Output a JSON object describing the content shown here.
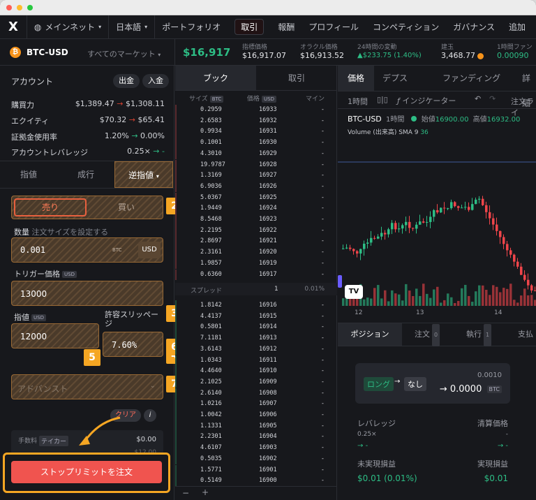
{
  "window": {
    "close_color": "#ff5f57",
    "min_color": "#febc2e",
    "max_color": "#28c840"
  },
  "topnav": {
    "logo": "X",
    "network": "メインネット",
    "language": "日本語",
    "items": [
      "ポートフォリオ",
      "取引",
      "報酬",
      "プロフィール",
      "コンペティション",
      "ガバナンス",
      "追加"
    ],
    "active": "取引",
    "globe_icon": "globe-icon",
    "chevron_icon": "chevron-down-icon"
  },
  "market": {
    "symbol": "BTC-USD",
    "all_markets": "すべてのマーケット",
    "price": "$16,917",
    "stats": [
      {
        "label": "指標価格",
        "value": "$16,917.07"
      },
      {
        "label": "オラクル価格",
        "value": "$16,913.52"
      },
      {
        "label": "24時間の変動",
        "value": "$233.75 (1.40%)"
      },
      {
        "label": "建玉",
        "value": "3,468.77"
      },
      {
        "label": "1時間ファン",
        "value": "0.00090"
      }
    ],
    "up_color": "#2dbd85",
    "accent": "#d4402f"
  },
  "account": {
    "title": "アカウント",
    "withdraw": "出金",
    "deposit": "入金",
    "rows": [
      {
        "label": "購買力",
        "from": "$1,389.47",
        "to": "$1,308.11"
      },
      {
        "label": "エクイティ",
        "from": "$70.32",
        "to": "$65.41"
      },
      {
        "label": "証拠金使用率",
        "from": "1.20%",
        "to": "0.00%"
      },
      {
        "label": "アカウントレバレッジ",
        "from": "0.25×",
        "to": "-"
      }
    ]
  },
  "order": {
    "tabs": [
      "指値",
      "成行",
      "逆指値"
    ],
    "active_tab": "逆指値",
    "sell": "売り",
    "buy": "買い",
    "amount_label": "数量",
    "amount_hint": "注文サイズを設定する",
    "amount_value": "0.001",
    "amount_unit": "BTC",
    "amount_toggle": "USD",
    "trigger_label": "トリガー価格",
    "trigger_unit": "USD",
    "trigger_value": "13000",
    "limit_label": "指値",
    "limit_unit": "USD",
    "limit_value": "12000",
    "slippage_label": "許容スリッページ",
    "slippage_value": "7.60%",
    "advanced": "アドバンスト",
    "clear": "クリア",
    "info": "i",
    "fee_label": "手数料",
    "fee_tag": "テイカー",
    "fee_value": "$0.00",
    "total_value": "$12.00",
    "submit": "ストップリミットを注文",
    "submit_color": "#f0544f"
  },
  "badges": [
    "1",
    "2",
    "3",
    "4",
    "5",
    "6",
    "7"
  ],
  "orderbook": {
    "tabs": [
      "ブック",
      "取引"
    ],
    "active_tab": "ブック",
    "head_size": "サイズ",
    "head_size_tag": "BTC",
    "head_price": "価格",
    "head_price_tag": "USD",
    "head_mine": "マイン",
    "asks": [
      {
        "size": "0.2959",
        "price": "16933"
      },
      {
        "size": "2.6583",
        "price": "16932"
      },
      {
        "size": "0.9934",
        "price": "16931"
      },
      {
        "size": "0.1001",
        "price": "16930"
      },
      {
        "size": "4.3010",
        "price": "16929"
      },
      {
        "size": "19.9787",
        "price": "16928"
      },
      {
        "size": "1.3169",
        "price": "16927"
      },
      {
        "size": "6.9036",
        "price": "16926"
      },
      {
        "size": "5.0367",
        "price": "16925"
      },
      {
        "size": "1.9449",
        "price": "16924"
      },
      {
        "size": "8.5468",
        "price": "16923"
      },
      {
        "size": "2.2195",
        "price": "16922"
      },
      {
        "size": "2.8697",
        "price": "16921"
      },
      {
        "size": "2.3161",
        "price": "16920"
      },
      {
        "size": "1.9857",
        "price": "16919"
      },
      {
        "size": "0.6360",
        "price": "16917"
      }
    ],
    "spread_label": "スプレッド",
    "spread_value": "1",
    "spread_pct": "0.01%",
    "bids": [
      {
        "size": "1.8142",
        "price": "16916"
      },
      {
        "size": "4.4137",
        "price": "16915"
      },
      {
        "size": "0.5801",
        "price": "16914"
      },
      {
        "size": "7.1181",
        "price": "16913"
      },
      {
        "size": "3.6143",
        "price": "16912"
      },
      {
        "size": "1.0343",
        "price": "16911"
      },
      {
        "size": "4.4640",
        "price": "16910"
      },
      {
        "size": "2.1025",
        "price": "16909"
      },
      {
        "size": "2.6140",
        "price": "16908"
      },
      {
        "size": "1.0216",
        "price": "16907"
      },
      {
        "size": "1.0042",
        "price": "16906"
      },
      {
        "size": "1.1331",
        "price": "16905"
      },
      {
        "size": "2.2301",
        "price": "16904"
      },
      {
        "size": "4.6107",
        "price": "16903"
      },
      {
        "size": "0.5035",
        "price": "16902"
      },
      {
        "size": "1.5771",
        "price": "16901"
      },
      {
        "size": "0.5149",
        "price": "16900"
      }
    ],
    "mine": "-",
    "zoom_minus": "−",
    "zoom_plus": "+"
  },
  "chart": {
    "tabs": [
      "価格",
      "デプス",
      "ファンディング",
      "詳細"
    ],
    "active_tab": "価格",
    "interval": "1時間",
    "indicator": "インジケーター",
    "order_line": "注文ライ",
    "title": "BTC-USD",
    "title_interval": "1時間",
    "open_label": "始値",
    "open_value": "16900.00",
    "high_label": "高値",
    "high_value": "16932.00",
    "volume_label": "Volume (出来高) SMA 9",
    "volume_value": "36",
    "x_ticks": [
      "12",
      "13",
      "14"
    ],
    "logo": "TV"
  },
  "positions": {
    "tabs": [
      {
        "label": "ポジション",
        "count": ""
      },
      {
        "label": "注文",
        "count": "0"
      },
      {
        "label": "執行",
        "count": "1"
      },
      {
        "label": "支払",
        "count": ""
      }
    ],
    "card": {
      "long": "ロング",
      "none": "なし",
      "amount_small": "0.0010",
      "amount": "0.0000",
      "unit": "BTC"
    },
    "leverage_label": "レバレッジ",
    "leverage_value": "0.25×",
    "leverage_next": "-",
    "liq_label": "清算価格",
    "liq_value": "-",
    "liq_next": "-",
    "unreal_label": "未実現損益",
    "unreal_value": "$0.01 (0.01%)",
    "real_label": "実現損益",
    "real_value": "$0.01"
  }
}
